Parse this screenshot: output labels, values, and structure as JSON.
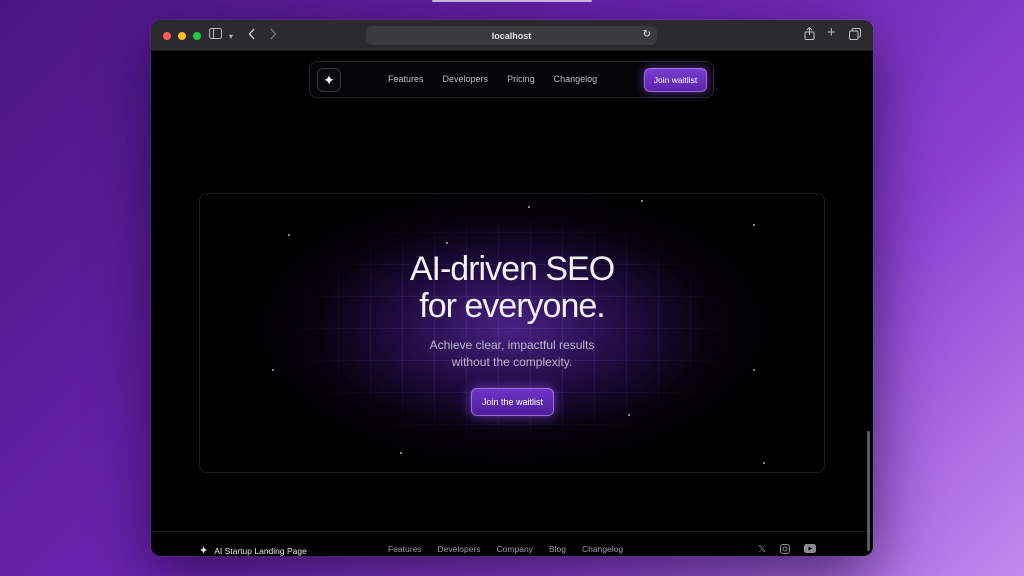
{
  "browser": {
    "url": "localhost",
    "icons": {
      "sidebar": "sidebar-icon",
      "sidebar_menu": "chevron-down-icon",
      "back": "back-icon",
      "forward": "forward-icon",
      "reload": "reload-icon",
      "share": "share-icon",
      "new_tab": "plus-icon",
      "tabs": "tabs-overview-icon"
    }
  },
  "nav": {
    "logo_icon": "sparkle-icon",
    "links": [
      "Features",
      "Developers",
      "Pricing",
      "Changelog"
    ],
    "cta": "Join waitlist"
  },
  "hero": {
    "title_line1": "AI-driven SEO",
    "title_line2": "for everyone.",
    "subtitle_line1": "Achieve clear, impactful results",
    "subtitle_line2": "without the complexity.",
    "cta": "Join the waitlist"
  },
  "footer": {
    "brand": "AI Startup Landing Page",
    "links": [
      "Features",
      "Developers",
      "Company",
      "Blog",
      "Changelog"
    ],
    "socials": [
      "x-icon",
      "instagram-icon",
      "youtube-icon"
    ]
  },
  "colors": {
    "accent": "#7b3fd4",
    "background": "#000000",
    "desktop_gradient_start": "#4a1580",
    "desktop_gradient_end": "#c28aee"
  }
}
